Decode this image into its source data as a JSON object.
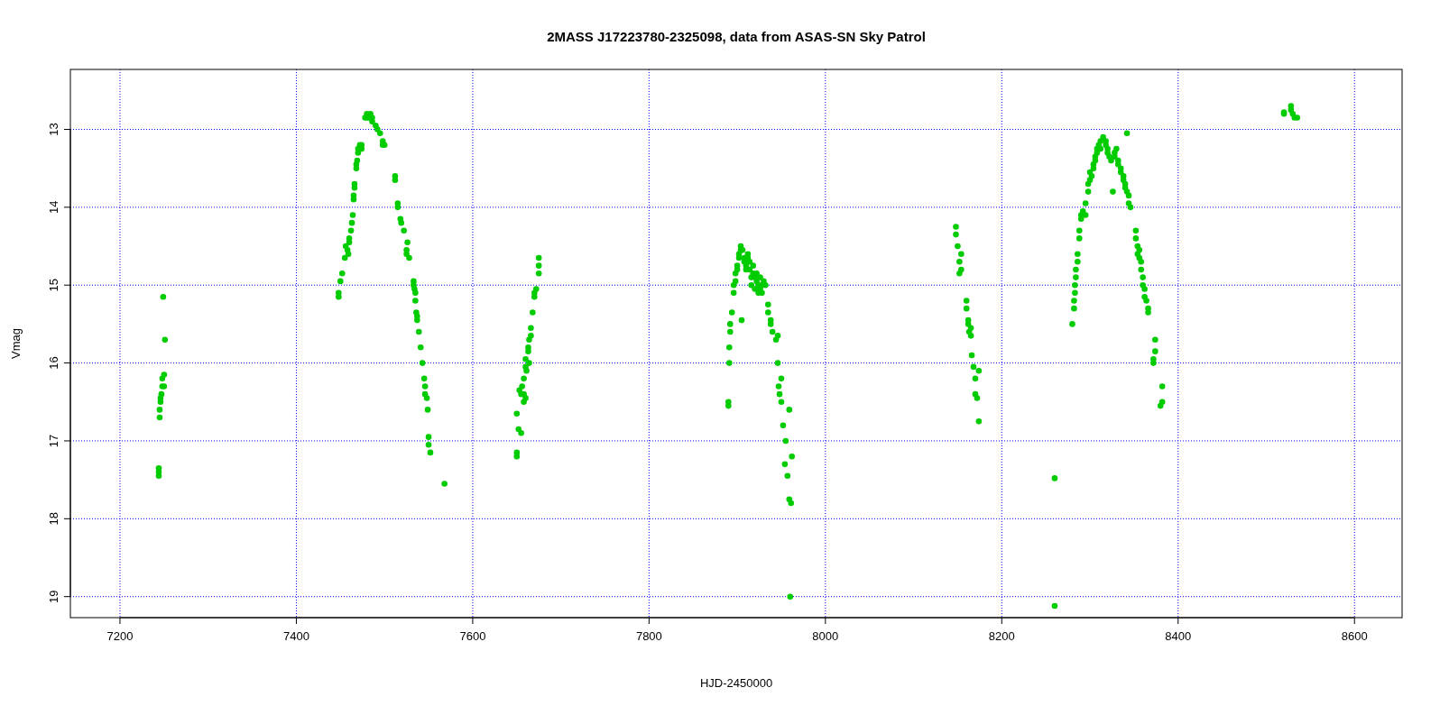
{
  "chart_data": {
    "type": "scatter",
    "grid": true,
    "title": "2MASS J17223780-2325098, data from ASAS-SN Sky Patrol",
    "xlabel": "HJD-2450000",
    "ylabel": "Vmag",
    "xlim": [
      7143.75,
      8654
    ],
    "ylim": [
      19.27,
      12.23
    ],
    "xticks": [
      7200,
      7400,
      7600,
      7800,
      8000,
      8200,
      8400,
      8600
    ],
    "yticks": [
      13,
      14,
      15,
      16,
      17,
      18,
      19
    ],
    "x": [
      7244,
      7244,
      7244,
      7245,
      7245,
      7246,
      7246,
      7247,
      7248,
      7248,
      7250,
      7250,
      7249,
      7251,
      7448,
      7448,
      7450,
      7452,
      7455,
      7456,
      7458,
      7459,
      7460,
      7460,
      7462,
      7463,
      7464,
      7465,
      7465,
      7466,
      7466,
      7468,
      7468,
      7469,
      7470,
      7470,
      7472,
      7474,
      7474,
      7478,
      7480,
      7480,
      7482,
      7484,
      7486,
      7486,
      7490,
      7492,
      7495,
      7498,
      7498,
      7500,
      7512,
      7512,
      7515,
      7515,
      7518,
      7519,
      7522,
      7525,
      7525,
      7526,
      7528,
      7533,
      7533,
      7534,
      7535,
      7535,
      7536,
      7537,
      7537,
      7539,
      7541,
      7543,
      7545,
      7546,
      7546,
      7548,
      7549,
      7550,
      7550,
      7552,
      7568,
      7650,
      7650,
      7650,
      7652,
      7653,
      7655,
      7655,
      7656,
      7658,
      7658,
      7658,
      7660,
      7660,
      7660,
      7661,
      7663,
      7663,
      7664,
      7664,
      7666,
      7666,
      7668,
      7670,
      7670,
      7672,
      7675,
      7675,
      7675,
      7890,
      7890,
      7891,
      7891,
      7892,
      7892,
      7894,
      7896,
      7896,
      7898,
      7898,
      7900,
      7900,
      7902,
      7902,
      7904,
      7904,
      7905,
      7906,
      7908,
      7908,
      7910,
      7910,
      7912,
      7912,
      7914,
      7914,
      7916,
      7916,
      7918,
      7918,
      7920,
      7920,
      7922,
      7922,
      7924,
      7924,
      7926,
      7926,
      7928,
      7928,
      7930,
      7932,
      7935,
      7935,
      7938,
      7938,
      7940,
      7944,
      7946,
      7946,
      7947,
      7948,
      7950,
      7950,
      7952,
      7954,
      7955,
      7957,
      7959,
      7959,
      7960,
      7961,
      7962,
      8148,
      8148,
      8150,
      8152,
      8152,
      8154,
      8154,
      8160,
      8160,
      8162,
      8162,
      8163,
      8165,
      8165,
      8166,
      8168,
      8170,
      8170,
      8172,
      8174,
      8174,
      8260,
      8260,
      8280,
      8282,
      8282,
      8283,
      8283,
      8284,
      8284,
      8286,
      8286,
      8288,
      8288,
      8290,
      8290,
      8292,
      8295,
      8295,
      8298,
      8298,
      8300,
      8300,
      8302,
      8304,
      8304,
      8306,
      8306,
      8308,
      8308,
      8310,
      8312,
      8312,
      8315,
      8318,
      8318,
      8320,
      8320,
      8322,
      8324,
      8326,
      8328,
      8328,
      8330,
      8332,
      8332,
      8335,
      8335,
      8338,
      8338,
      8340,
      8340,
      8342,
      8342,
      8344,
      8344,
      8346,
      8352,
      8352,
      8354,
      8354,
      8356,
      8356,
      8358,
      8358,
      8360,
      8360,
      8362,
      8362,
      8364,
      8366,
      8366,
      8372,
      8372,
      8374,
      8374,
      8380,
      8382,
      8382,
      8520,
      8520,
      8528,
      8528,
      8530,
      8532,
      8535
    ],
    "series": [
      {
        "color": "#00cc00",
        "values": [
          17.35,
          17.4,
          17.45,
          16.7,
          16.6,
          16.5,
          16.45,
          16.4,
          16.3,
          16.2,
          16.15,
          16.3,
          15.15,
          15.7,
          15.15,
          15.1,
          14.95,
          14.85,
          14.65,
          14.5,
          14.55,
          14.6,
          14.45,
          14.4,
          14.3,
          14.2,
          14.1,
          13.9,
          13.85,
          13.75,
          13.7,
          13.5,
          13.45,
          13.4,
          13.25,
          13.3,
          13.2,
          13.25,
          13.2,
          12.85,
          12.8,
          12.85,
          12.85,
          12.8,
          12.85,
          12.9,
          12.95,
          13.0,
          13.05,
          13.15,
          13.2,
          13.2,
          13.6,
          13.65,
          13.95,
          14.0,
          14.15,
          14.2,
          14.3,
          14.55,
          14.6,
          14.45,
          14.65,
          14.95,
          15.0,
          15.05,
          15.1,
          15.2,
          15.35,
          15.4,
          15.45,
          15.6,
          15.8,
          16.0,
          16.2,
          16.3,
          16.4,
          16.45,
          16.6,
          16.95,
          17.05,
          17.15,
          17.55,
          16.65,
          17.15,
          17.2,
          16.85,
          16.35,
          16.9,
          16.4,
          16.3,
          16.4,
          16.2,
          16.5,
          16.45,
          16.05,
          15.95,
          16.1,
          15.8,
          15.85,
          16.0,
          15.7,
          15.55,
          15.65,
          15.35,
          15.1,
          15.15,
          15.05,
          14.65,
          14.75,
          14.85,
          16.5,
          16.55,
          15.8,
          16.0,
          15.6,
          15.5,
          15.35,
          15.1,
          15.0,
          14.95,
          14.85,
          14.8,
          14.75,
          14.65,
          14.6,
          14.55,
          14.5,
          15.45,
          14.55,
          14.65,
          14.7,
          14.75,
          14.8,
          14.6,
          14.65,
          14.8,
          14.7,
          14.9,
          15.0,
          14.75,
          14.85,
          14.9,
          15.05,
          14.85,
          14.95,
          15.0,
          15.1,
          14.9,
          15.05,
          15.1,
          15.0,
          14.95,
          15.0,
          15.25,
          15.35,
          15.45,
          15.5,
          15.6,
          15.7,
          15.65,
          16.0,
          16.3,
          16.4,
          16.2,
          16.5,
          16.8,
          17.3,
          17.0,
          17.45,
          16.6,
          17.75,
          19.0,
          17.8,
          17.2,
          14.25,
          14.35,
          14.5,
          14.7,
          14.85,
          14.8,
          14.6,
          15.2,
          15.3,
          15.45,
          15.5,
          15.6,
          15.55,
          15.65,
          15.9,
          16.05,
          16.2,
          16.4,
          16.45,
          16.1,
          16.75,
          17.48,
          19.12,
          15.5,
          15.3,
          15.2,
          15.1,
          15.0,
          14.9,
          14.8,
          14.7,
          14.6,
          14.4,
          14.3,
          14.15,
          14.1,
          14.05,
          14.1,
          13.95,
          13.8,
          13.7,
          13.65,
          13.55,
          13.6,
          13.5,
          13.45,
          13.35,
          13.4,
          13.3,
          13.25,
          13.2,
          13.15,
          13.25,
          13.1,
          13.15,
          13.2,
          13.25,
          13.3,
          13.35,
          13.4,
          13.8,
          13.3,
          13.35,
          13.25,
          13.4,
          13.45,
          13.5,
          13.55,
          13.6,
          13.65,
          13.7,
          13.75,
          13.05,
          13.8,
          13.85,
          13.95,
          14.0,
          14.3,
          14.4,
          14.5,
          14.6,
          14.55,
          14.65,
          14.7,
          14.8,
          14.9,
          15.0,
          15.05,
          15.15,
          15.2,
          15.3,
          15.35,
          15.95,
          16.0,
          15.7,
          15.85,
          16.55,
          16.5,
          16.3,
          12.78,
          12.8,
          12.7,
          12.75,
          12.8,
          12.85,
          12.85
        ]
      }
    ]
  }
}
